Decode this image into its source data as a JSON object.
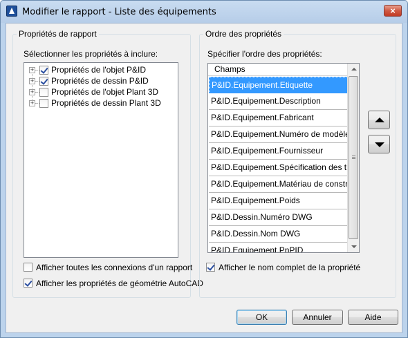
{
  "window": {
    "title": "Modifier le rapport - Liste des équipements",
    "close_glyph": "×"
  },
  "left_group": {
    "title": "Propriétés de rapport",
    "instruction": "Sélectionner les propriétés à inclure:",
    "tree_items": [
      {
        "label": "Propriétés de l'objet P&ID",
        "checked": true,
        "expander": "+"
      },
      {
        "label": "Propriétés de dessin P&ID",
        "checked": true,
        "expander": "+"
      },
      {
        "label": "Propriétés de l'objet Plant 3D",
        "checked": false,
        "expander": "+"
      },
      {
        "label": "Propriétés de dessin Plant 3D",
        "checked": false,
        "expander": "+"
      }
    ],
    "options": [
      {
        "label": "Afficher toutes les connexions d'un rapport",
        "checked": false
      },
      {
        "label": "Afficher les propriétés de géométrie AutoCAD",
        "checked": true
      }
    ]
  },
  "right_group": {
    "title": "Ordre des propriétés",
    "instruction": "Spécifier l'ordre des propriétés:",
    "list_header": "Champs",
    "list_items": [
      {
        "label": "P&ID.Equipement.Etiquette",
        "selected": true
      },
      {
        "label": "P&ID.Equipement.Description",
        "selected": false
      },
      {
        "label": "P&ID.Equipement.Fabricant",
        "selected": false
      },
      {
        "label": "P&ID.Equipement.Numéro de modèle",
        "selected": false
      },
      {
        "label": "P&ID.Equipement.Fournisseur",
        "selected": false
      },
      {
        "label": "P&ID.Equipement.Spécification des tuy...",
        "selected": false
      },
      {
        "label": "P&ID.Equipement.Matériau de constru...",
        "selected": false
      },
      {
        "label": "P&ID.Equipement.Poids",
        "selected": false
      },
      {
        "label": "P&ID.Dessin.Numéro DWG",
        "selected": false
      },
      {
        "label": "P&ID.Dessin.Nom DWG",
        "selected": false
      },
      {
        "label": "P&ID.Equipement.PnPID",
        "selected": false
      }
    ],
    "option": {
      "label": "Afficher le nom complet de la propriété",
      "checked": true
    },
    "move_up_icon": "triangle-up",
    "move_down_icon": "triangle-down"
  },
  "buttons": {
    "ok": "OK",
    "cancel": "Annuler",
    "help": "Aide"
  },
  "colors": {
    "selection": "#3399ff",
    "title_bar": "#bcd3ec",
    "close_button": "#c23b24"
  }
}
